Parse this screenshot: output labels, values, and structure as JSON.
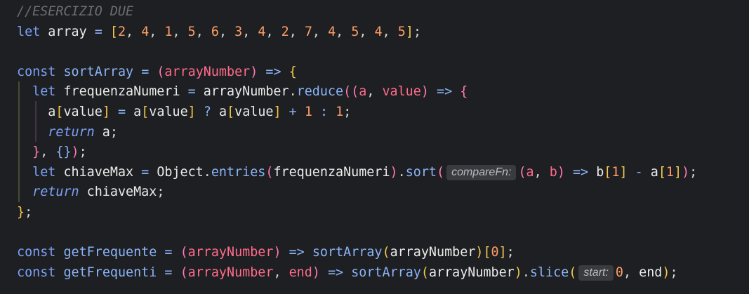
{
  "code_lines": [
    [
      {
        "t": "//ESERCIZIO DUE",
        "c": "comment"
      }
    ],
    [
      {
        "t": "let",
        "c": "keyword"
      },
      {
        "t": " array ",
        "c": "ident"
      },
      {
        "t": "=",
        "c": "op"
      },
      {
        "t": " ",
        "c": "ident"
      },
      {
        "t": "[",
        "c": "bracket"
      },
      {
        "t": "2",
        "c": "number"
      },
      {
        "t": ", ",
        "c": "punct"
      },
      {
        "t": "4",
        "c": "number"
      },
      {
        "t": ", ",
        "c": "punct"
      },
      {
        "t": "1",
        "c": "number"
      },
      {
        "t": ", ",
        "c": "punct"
      },
      {
        "t": "5",
        "c": "number"
      },
      {
        "t": ", ",
        "c": "punct"
      },
      {
        "t": "6",
        "c": "number"
      },
      {
        "t": ", ",
        "c": "punct"
      },
      {
        "t": "3",
        "c": "number"
      },
      {
        "t": ", ",
        "c": "punct"
      },
      {
        "t": "4",
        "c": "number"
      },
      {
        "t": ", ",
        "c": "punct"
      },
      {
        "t": "2",
        "c": "number"
      },
      {
        "t": ", ",
        "c": "punct"
      },
      {
        "t": "7",
        "c": "number"
      },
      {
        "t": ", ",
        "c": "punct"
      },
      {
        "t": "4",
        "c": "number"
      },
      {
        "t": ", ",
        "c": "punct"
      },
      {
        "t": "5",
        "c": "number"
      },
      {
        "t": ", ",
        "c": "punct"
      },
      {
        "t": "4",
        "c": "number"
      },
      {
        "t": ", ",
        "c": "punct"
      },
      {
        "t": "5",
        "c": "number"
      },
      {
        "t": "]",
        "c": "bracket"
      },
      {
        "t": ";",
        "c": "punct"
      }
    ],
    [],
    [
      {
        "t": "const",
        "c": "keyword"
      },
      {
        "t": " ",
        "c": "ident"
      },
      {
        "t": "sortArray",
        "c": "fn"
      },
      {
        "t": " ",
        "c": "ident"
      },
      {
        "t": "=",
        "c": "op"
      },
      {
        "t": " ",
        "c": "ident"
      },
      {
        "t": "(",
        "c": "paren"
      },
      {
        "t": "arrayNumber",
        "c": "param"
      },
      {
        "t": ")",
        "c": "paren"
      },
      {
        "t": " ",
        "c": "ident"
      },
      {
        "t": "=>",
        "c": "op"
      },
      {
        "t": " ",
        "c": "ident"
      },
      {
        "t": "{",
        "c": "bracket"
      }
    ],
    [
      {
        "t": "  ",
        "c": "ident"
      },
      {
        "t": "let",
        "c": "keyword"
      },
      {
        "t": " frequenzaNumeri ",
        "c": "ident"
      },
      {
        "t": "=",
        "c": "op"
      },
      {
        "t": " arrayNumber",
        "c": "ident"
      },
      {
        "t": ".",
        "c": "punct"
      },
      {
        "t": "reduce",
        "c": "fn"
      },
      {
        "t": "(",
        "c": "paren"
      },
      {
        "t": "(",
        "c": "paren"
      },
      {
        "t": "a",
        "c": "param"
      },
      {
        "t": ", ",
        "c": "punct"
      },
      {
        "t": "value",
        "c": "param"
      },
      {
        "t": ")",
        "c": "paren"
      },
      {
        "t": " ",
        "c": "ident"
      },
      {
        "t": "=>",
        "c": "op"
      },
      {
        "t": " ",
        "c": "ident"
      },
      {
        "t": "{",
        "c": "paren"
      }
    ],
    [
      {
        "t": "    ",
        "c": "ident"
      },
      {
        "t": "a",
        "c": "ident"
      },
      {
        "t": "[",
        "c": "bracket"
      },
      {
        "t": "value",
        "c": "ident"
      },
      {
        "t": "]",
        "c": "bracket"
      },
      {
        "t": " ",
        "c": "ident"
      },
      {
        "t": "=",
        "c": "op"
      },
      {
        "t": " ",
        "c": "ident"
      },
      {
        "t": "a",
        "c": "ident"
      },
      {
        "t": "[",
        "c": "bracket"
      },
      {
        "t": "value",
        "c": "ident"
      },
      {
        "t": "]",
        "c": "bracket"
      },
      {
        "t": " ",
        "c": "ident"
      },
      {
        "t": "?",
        "c": "op"
      },
      {
        "t": " ",
        "c": "ident"
      },
      {
        "t": "a",
        "c": "ident"
      },
      {
        "t": "[",
        "c": "bracket"
      },
      {
        "t": "value",
        "c": "ident"
      },
      {
        "t": "]",
        "c": "bracket"
      },
      {
        "t": " ",
        "c": "ident"
      },
      {
        "t": "+",
        "c": "op"
      },
      {
        "t": " ",
        "c": "ident"
      },
      {
        "t": "1",
        "c": "number"
      },
      {
        "t": " ",
        "c": "ident"
      },
      {
        "t": ":",
        "c": "op"
      },
      {
        "t": " ",
        "c": "ident"
      },
      {
        "t": "1",
        "c": "number"
      },
      {
        "t": ";",
        "c": "punct"
      }
    ],
    [
      {
        "t": "    ",
        "c": "ident"
      },
      {
        "t": "return",
        "c": "italic-keyword"
      },
      {
        "t": " a",
        "c": "ident"
      },
      {
        "t": ";",
        "c": "punct"
      }
    ],
    [
      {
        "t": "  ",
        "c": "ident"
      },
      {
        "t": "}",
        "c": "paren"
      },
      {
        "t": ", ",
        "c": "punct"
      },
      {
        "t": "{}",
        "c": "fn"
      },
      {
        "t": ")",
        "c": "paren"
      },
      {
        "t": ";",
        "c": "punct"
      }
    ],
    [
      {
        "t": "  ",
        "c": "ident"
      },
      {
        "t": "let",
        "c": "keyword"
      },
      {
        "t": " chiaveMax ",
        "c": "ident"
      },
      {
        "t": "=",
        "c": "op"
      },
      {
        "t": " Object",
        "c": "ident"
      },
      {
        "t": ".",
        "c": "punct"
      },
      {
        "t": "entries",
        "c": "fn"
      },
      {
        "t": "(",
        "c": "paren"
      },
      {
        "t": "frequenzaNumeri",
        "c": "ident"
      },
      {
        "t": ")",
        "c": "paren"
      },
      {
        "t": ".",
        "c": "punct"
      },
      {
        "t": "sort",
        "c": "fn"
      },
      {
        "t": "(",
        "c": "paren"
      },
      {
        "t": "compareFn:",
        "c": "hint"
      },
      {
        "t": "(",
        "c": "paren"
      },
      {
        "t": "a",
        "c": "param"
      },
      {
        "t": ", ",
        "c": "punct"
      },
      {
        "t": "b",
        "c": "param"
      },
      {
        "t": ")",
        "c": "paren"
      },
      {
        "t": " ",
        "c": "ident"
      },
      {
        "t": "=>",
        "c": "op"
      },
      {
        "t": " b",
        "c": "ident"
      },
      {
        "t": "[",
        "c": "bracket"
      },
      {
        "t": "1",
        "c": "number"
      },
      {
        "t": "]",
        "c": "bracket"
      },
      {
        "t": " ",
        "c": "ident"
      },
      {
        "t": "-",
        "c": "op"
      },
      {
        "t": " a",
        "c": "ident"
      },
      {
        "t": "[",
        "c": "bracket"
      },
      {
        "t": "1",
        "c": "number"
      },
      {
        "t": "]",
        "c": "bracket"
      },
      {
        "t": ")",
        "c": "paren"
      },
      {
        "t": ";",
        "c": "punct"
      }
    ],
    [
      {
        "t": "  ",
        "c": "ident"
      },
      {
        "t": "return",
        "c": "italic-keyword"
      },
      {
        "t": " chiaveMax",
        "c": "ident"
      },
      {
        "t": ";",
        "c": "punct"
      }
    ],
    [
      {
        "t": "}",
        "c": "bracket"
      },
      {
        "t": ";",
        "c": "punct"
      }
    ],
    [],
    [
      {
        "t": "const",
        "c": "keyword"
      },
      {
        "t": " ",
        "c": "ident"
      },
      {
        "t": "getFrequente",
        "c": "fn"
      },
      {
        "t": " ",
        "c": "ident"
      },
      {
        "t": "=",
        "c": "op"
      },
      {
        "t": " ",
        "c": "ident"
      },
      {
        "t": "(",
        "c": "paren"
      },
      {
        "t": "arrayNumber",
        "c": "param"
      },
      {
        "t": ")",
        "c": "paren"
      },
      {
        "t": " ",
        "c": "ident"
      },
      {
        "t": "=>",
        "c": "op"
      },
      {
        "t": " ",
        "c": "ident"
      },
      {
        "t": "sortArray",
        "c": "fn"
      },
      {
        "t": "(",
        "c": "bracket"
      },
      {
        "t": "arrayNumber",
        "c": "ident"
      },
      {
        "t": ")",
        "c": "bracket"
      },
      {
        "t": "[",
        "c": "bracket"
      },
      {
        "t": "0",
        "c": "number"
      },
      {
        "t": "]",
        "c": "bracket"
      },
      {
        "t": ";",
        "c": "punct"
      }
    ],
    [
      {
        "t": "const",
        "c": "keyword"
      },
      {
        "t": " ",
        "c": "ident"
      },
      {
        "t": "getFrequenti",
        "c": "fn"
      },
      {
        "t": " ",
        "c": "ident"
      },
      {
        "t": "=",
        "c": "op"
      },
      {
        "t": " ",
        "c": "ident"
      },
      {
        "t": "(",
        "c": "paren"
      },
      {
        "t": "arrayNumber",
        "c": "param"
      },
      {
        "t": ", ",
        "c": "punct"
      },
      {
        "t": "end",
        "c": "param"
      },
      {
        "t": ")",
        "c": "paren"
      },
      {
        "t": " ",
        "c": "ident"
      },
      {
        "t": "=>",
        "c": "op"
      },
      {
        "t": " ",
        "c": "ident"
      },
      {
        "t": "sortArray",
        "c": "fn"
      },
      {
        "t": "(",
        "c": "bracket"
      },
      {
        "t": "arrayNumber",
        "c": "ident"
      },
      {
        "t": ")",
        "c": "bracket"
      },
      {
        "t": ".",
        "c": "punct"
      },
      {
        "t": "slice",
        "c": "fn"
      },
      {
        "t": "(",
        "c": "bracket"
      },
      {
        "t": "start:",
        "c": "hint"
      },
      {
        "t": "0",
        "c": "number"
      },
      {
        "t": ", ",
        "c": "punct"
      },
      {
        "t": "end",
        "c": "ident"
      },
      {
        "t": ")",
        "c": "bracket"
      },
      {
        "t": ";",
        "c": "punct"
      }
    ]
  ],
  "colors": {
    "background": "#1e1f22",
    "keyword": "#7aa2f7",
    "number": "#ff9e64",
    "bracket": "#f2c94c",
    "paren": "#ff7ab2",
    "comment": "#6b6e73"
  }
}
